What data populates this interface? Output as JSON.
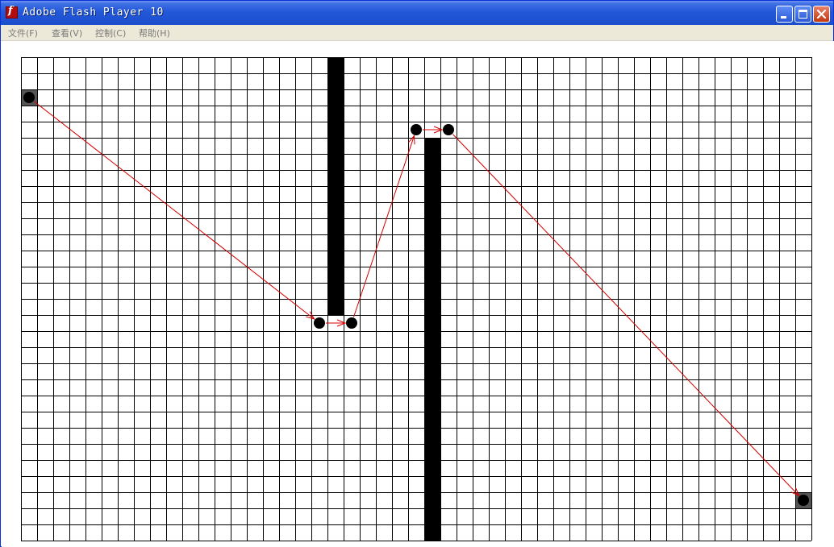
{
  "window": {
    "title": "Adobe Flash Player 10",
    "app_icon": "flash-player-icon",
    "app_icon_glyph": "f",
    "controls": [
      "minimize-icon",
      "maximize-icon",
      "close-icon"
    ]
  },
  "menu": {
    "file": "文件(F)",
    "view": "查看(V)",
    "control": "控制(C)",
    "help": "帮助(H)"
  },
  "stage": {
    "grid": {
      "columns": 49,
      "rows": 30
    },
    "walls": [
      {
        "col": 19,
        "row_start": 0,
        "row_end": 15
      },
      {
        "col": 25,
        "row_start": 5,
        "row_end": 29
      }
    ],
    "start_cell": {
      "col": 0,
      "row": 2
    },
    "end_cell": {
      "col": 48,
      "row": 27
    },
    "path_nodes": [
      {
        "col": 0,
        "row": 2,
        "role": "start"
      },
      {
        "col": 18,
        "row": 16,
        "role": "waypoint"
      },
      {
        "col": 20,
        "row": 16,
        "role": "waypoint"
      },
      {
        "col": 24,
        "row": 4,
        "role": "waypoint"
      },
      {
        "col": 26,
        "row": 4,
        "role": "waypoint"
      },
      {
        "col": 48,
        "row": 27,
        "role": "goal"
      }
    ],
    "colors": {
      "grid_line": "#000000",
      "wall": "#000000",
      "node": "#000000",
      "endpoint_cell": "#555555",
      "path_arrow": "#d40000"
    }
  }
}
